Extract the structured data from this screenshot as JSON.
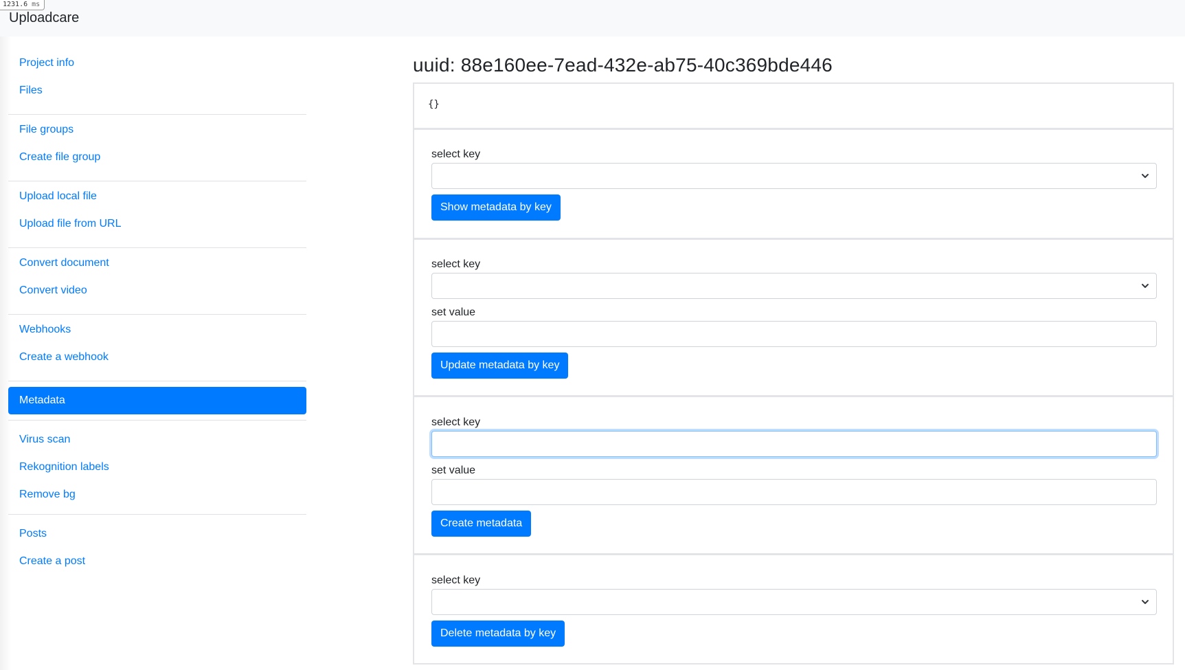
{
  "perf": {
    "value": "1231.6",
    "unit": "ms"
  },
  "brand": "Uploadcare",
  "sidebar": {
    "groups": [
      {
        "items": [
          {
            "label": "Project info"
          },
          {
            "label": "Files"
          }
        ]
      },
      {
        "items": [
          {
            "label": "File groups"
          },
          {
            "label": "Create file group"
          }
        ]
      },
      {
        "items": [
          {
            "label": "Upload local file"
          },
          {
            "label": "Upload file from URL"
          }
        ]
      },
      {
        "items": [
          {
            "label": "Convert document"
          },
          {
            "label": "Convert video"
          }
        ]
      },
      {
        "items": [
          {
            "label": "Webhooks"
          },
          {
            "label": "Create a webhook"
          }
        ]
      },
      {
        "items": [
          {
            "label": "Metadata",
            "active": true
          }
        ]
      },
      {
        "items": [
          {
            "label": "Virus scan"
          },
          {
            "label": "Rekognition labels"
          },
          {
            "label": "Remove bg"
          }
        ]
      },
      {
        "items": [
          {
            "label": "Posts"
          },
          {
            "label": "Create a post"
          }
        ]
      }
    ]
  },
  "page": {
    "title": "uuid: 88e160ee-7ead-432e-ab75-40c369bde446",
    "json_output": "{}"
  },
  "forms": {
    "show": {
      "key_label": "select key",
      "key_value": "",
      "button": "Show metadata by key"
    },
    "update": {
      "key_label": "select key",
      "key_value": "",
      "value_label": "set value",
      "value": "",
      "button": "Update metadata by key"
    },
    "create": {
      "key_label": "select key",
      "key_value": "",
      "value_label": "set value",
      "value": "",
      "button": "Create metadata"
    },
    "delete": {
      "key_label": "select key",
      "key_value": "",
      "button": "Delete metadata by key"
    }
  },
  "colors": {
    "accent": "#007bff",
    "navbar_bg": "#f8f9fa",
    "card_border": "#e3e4e8"
  }
}
